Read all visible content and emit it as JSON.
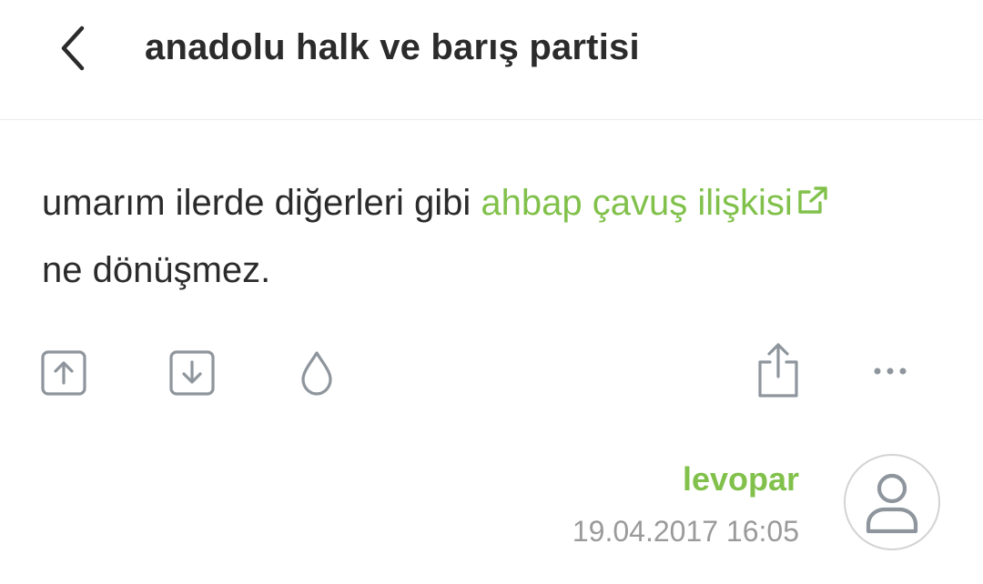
{
  "header": {
    "back_icon": "chevron-left-icon",
    "title": "anadolu halk ve barış partisi"
  },
  "entry": {
    "text_before": "umarım ilerde diğerleri gibi ",
    "link_text": "ahbap çavuş ilişkisi",
    "link_icon": "external-link-icon",
    "text_after": "ne dönüşmez."
  },
  "actions": {
    "icons": [
      "upvote-icon",
      "downvote-icon",
      "drop-icon",
      "share-icon",
      "more-icon"
    ]
  },
  "meta": {
    "author": "levopar",
    "timestamp": "19.04.2017 16:05",
    "avatar_icon": "user-icon"
  },
  "colors": {
    "accent": "#81c14b",
    "text": "#2b2b2b",
    "icon": "#8e959c",
    "muted": "#9a9a9a"
  }
}
